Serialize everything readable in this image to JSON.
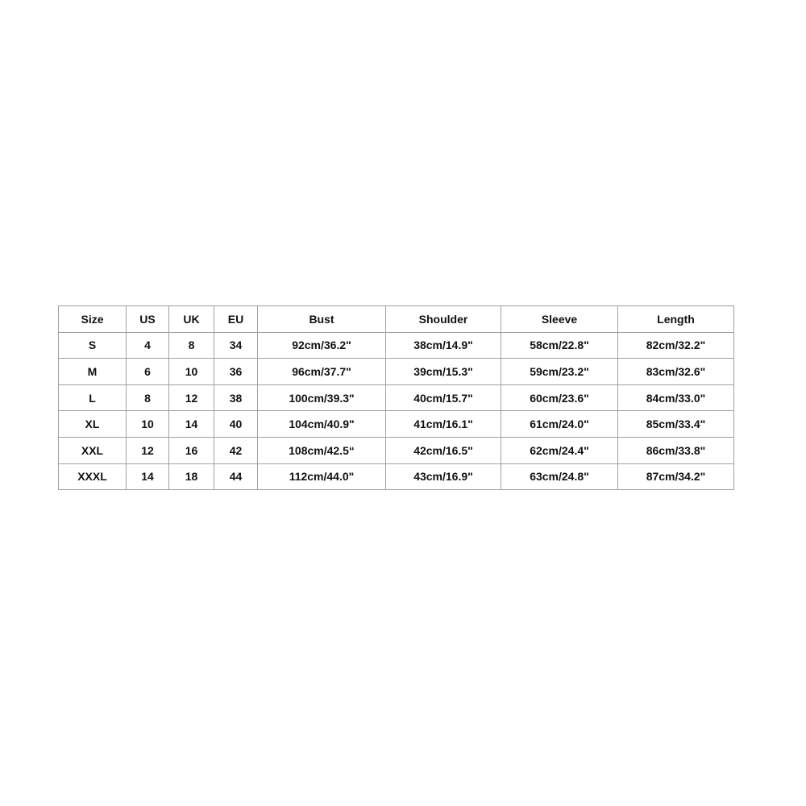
{
  "size_chart": {
    "headers": [
      "Size",
      "US",
      "UK",
      "EU",
      "Bust",
      "Shoulder",
      "Sleeve",
      "Length"
    ],
    "rows": [
      [
        "S",
        "4",
        "8",
        "34",
        "92cm/36.2\"",
        "38cm/14.9\"",
        "58cm/22.8\"",
        "82cm/32.2\""
      ],
      [
        "M",
        "6",
        "10",
        "36",
        "96cm/37.7\"",
        "39cm/15.3\"",
        "59cm/23.2\"",
        "83cm/32.6\""
      ],
      [
        "L",
        "8",
        "12",
        "38",
        "100cm/39.3\"",
        "40cm/15.7\"",
        "60cm/23.6\"",
        "84cm/33.0\""
      ],
      [
        "XL",
        "10",
        "14",
        "40",
        "104cm/40.9\"",
        "41cm/16.1\"",
        "61cm/24.0\"",
        "85cm/33.4\""
      ],
      [
        "XXL",
        "12",
        "16",
        "42",
        "108cm/42.5“",
        "42cm/16.5\"",
        "62cm/24.4\"",
        "86cm/33.8\""
      ],
      [
        "XXXL",
        "14",
        "18",
        "44",
        "112cm/44.0\"",
        "43cm/16.9\"",
        "63cm/24.8\"",
        "87cm/34.2\""
      ]
    ]
  }
}
